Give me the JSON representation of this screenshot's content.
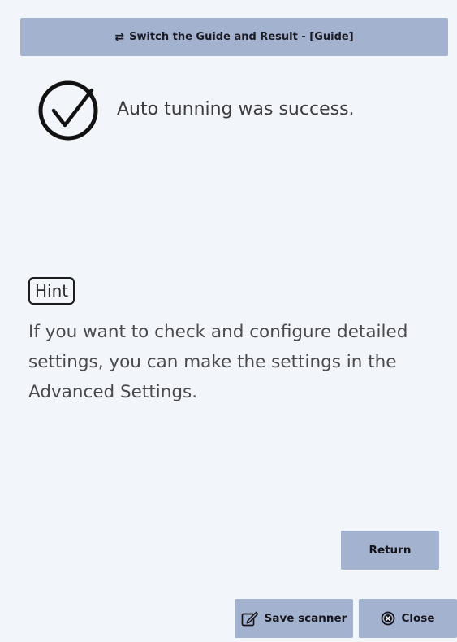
{
  "switch_bar": {
    "icon": "swap-arrows-icon",
    "label": "Switch the Guide and Result - [Guide]"
  },
  "result": {
    "icon": "check-circle-icon",
    "message": "Auto tunning was success."
  },
  "hint": {
    "badge": "Hint",
    "text": "If you want to check and configure detailed settings, you can make the settings in the Advanced Settings."
  },
  "buttons": {
    "return_label": "Return",
    "save_label": "Save scanner",
    "save_icon": "edit-icon",
    "close_label": "Close",
    "close_icon": "close-circle-icon"
  },
  "colors": {
    "background": "#f2f5fa",
    "button_bg": "#a3b2cf"
  }
}
